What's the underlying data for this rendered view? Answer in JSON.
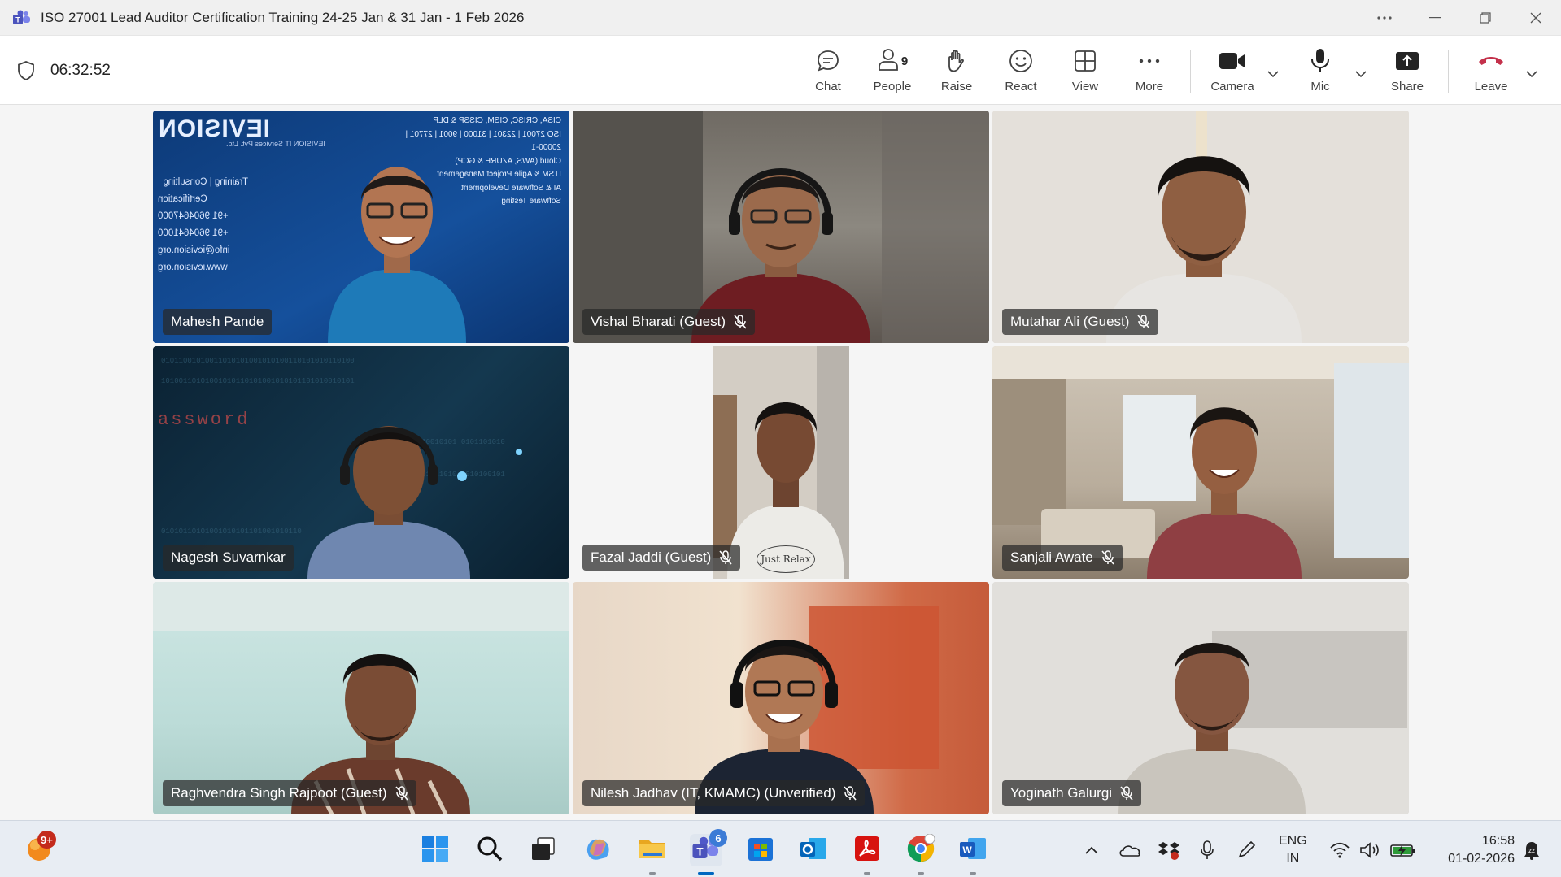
{
  "window": {
    "title": "ISO 27001 Lead Auditor Certification Training 24-25 Jan & 31 Jan - 1 Feb 2026",
    "icon": "teams-icon"
  },
  "toolbar": {
    "timer": "06:32:52",
    "chat_label": "Chat",
    "people_label": "People",
    "people_count": "9",
    "raise_label": "Raise",
    "react_label": "React",
    "view_label": "View",
    "more_label": "More",
    "camera_label": "Camera",
    "mic_label": "Mic",
    "share_label": "Share",
    "leave_label": "Leave"
  },
  "participants": [
    {
      "name": "Mahesh Pande",
      "muted": false
    },
    {
      "name": "Vishal Bharati (Guest)",
      "muted": true
    },
    {
      "name": "Mutahar Ali (Guest)",
      "muted": true
    },
    {
      "name": "Nagesh Suvarnkar",
      "muted": false
    },
    {
      "name": "Fazal Jaddi (Guest)",
      "muted": true
    },
    {
      "name": "Sanjali Awate",
      "muted": true
    },
    {
      "name": "Raghvendra Singh Rajpoot (Guest)",
      "muted": true
    },
    {
      "name": "Nilesh Jadhav (IT, KMAMC) (Unverified)",
      "muted": true
    },
    {
      "name": "Yoginath Galurgi",
      "muted": true
    }
  ],
  "backgrounds": {
    "ievision": {
      "logo": "IEVISION",
      "tagline": "IEVISION IT Services Pvt. Ltd.",
      "services": [
        "Training | Consulting | Certification"
      ],
      "bullets": [
        "CISA, CRISC, CISM, CISSP & DLP",
        "ISO 27001 | 22301 | 31000 | 9001 | 27701 | 20000-1",
        "Cloud (AWS, AZURE & GCP)",
        "ITSM & Agile Project Management",
        "AI & Software Development",
        "Software Testing"
      ],
      "phones": [
        "+91 9604647000",
        "+91 9604641000"
      ],
      "email": "info@ievision.org",
      "web": "www.ievision.org"
    },
    "password_word": "assword",
    "shirt_text": "Just Relax"
  },
  "taskbar": {
    "widget_badge": "9+",
    "teams_badge": "6",
    "lang_top": "ENG",
    "lang_bottom": "IN",
    "time": "16:58",
    "date": "01-02-2026"
  },
  "colors": {
    "accent": "#0f6cbd",
    "leave_red": "#c4314b",
    "nametag_bg": "#282828"
  }
}
